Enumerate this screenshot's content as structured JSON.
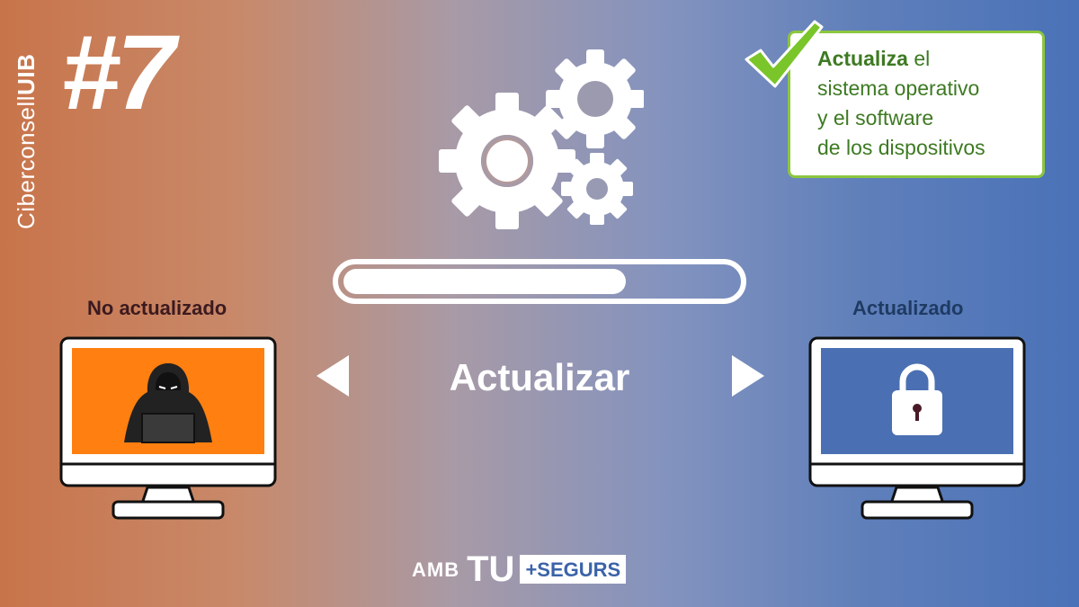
{
  "brand": {
    "prefix": "Ciberconsell",
    "suffix": "UIB"
  },
  "tip_number": "#7",
  "callout": {
    "bold": "Actualiza",
    "rest_first_line": " el",
    "lines": [
      "sistema operativo",
      "y el software",
      "de los dispositivos"
    ]
  },
  "progress": {
    "fraction": 0.72
  },
  "left": {
    "label": "No actualizado",
    "screen_color": "#ff7f10"
  },
  "right": {
    "label": "Actualizado",
    "screen_color": "#4a6fb3"
  },
  "center": {
    "label": "Actualizar"
  },
  "footer": {
    "amb": "AMB",
    "tu": "TU",
    "segurs": "+SEGURS"
  },
  "colors": {
    "accent_green": "#8cc63f",
    "text_green": "#3d7a22"
  }
}
